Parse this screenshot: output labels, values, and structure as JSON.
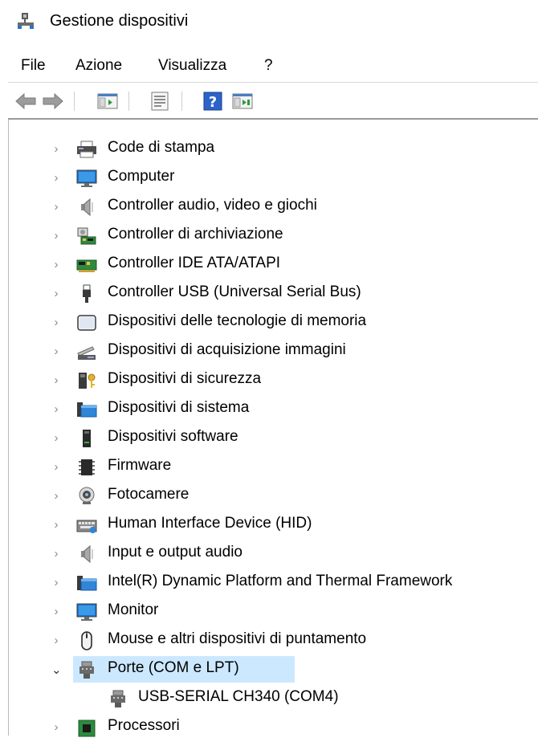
{
  "window": {
    "title": "Gestione dispositivi",
    "icon": "device-manager-icon"
  },
  "menu": [
    {
      "label": "File"
    },
    {
      "label": "Azione"
    },
    {
      "label": "Visualizza"
    },
    {
      "label": "?"
    }
  ],
  "toolbar": {
    "buttons": [
      "back-arrow-icon",
      "forward-arrow-icon",
      "show-hide-console-tree-icon",
      "properties-icon",
      "help-icon",
      "scan-hardware-icon"
    ]
  },
  "tree": {
    "items": [
      {
        "label": "Code di stampa",
        "icon": "printer-icon",
        "state": "collapsed"
      },
      {
        "label": "Computer",
        "icon": "computer-icon",
        "state": "collapsed"
      },
      {
        "label": "Controller audio, video e giochi",
        "icon": "speaker-icon",
        "state": "collapsed"
      },
      {
        "label": "Controller di archiviazione",
        "icon": "storage-controller-icon",
        "state": "collapsed"
      },
      {
        "label": "Controller IDE ATA/ATAPI",
        "icon": "ide-controller-icon",
        "state": "collapsed"
      },
      {
        "label": "Controller USB (Universal Serial Bus)",
        "icon": "usb-plug-icon",
        "state": "collapsed"
      },
      {
        "label": "Dispositivi delle tecnologie di memoria",
        "icon": "memory-device-icon",
        "state": "collapsed"
      },
      {
        "label": "Dispositivi di acquisizione immagini",
        "icon": "scanner-icon",
        "state": "collapsed"
      },
      {
        "label": "Dispositivi di sicurezza",
        "icon": "security-key-icon",
        "state": "collapsed"
      },
      {
        "label": "Dispositivi di sistema",
        "icon": "system-folder-icon",
        "state": "collapsed"
      },
      {
        "label": "Dispositivi software",
        "icon": "software-device-icon",
        "state": "collapsed"
      },
      {
        "label": "Firmware",
        "icon": "firmware-chip-icon",
        "state": "collapsed"
      },
      {
        "label": "Fotocamere",
        "icon": "webcam-icon",
        "state": "collapsed"
      },
      {
        "label": "Human Interface Device (HID)",
        "icon": "hid-keyboard-icon",
        "state": "collapsed"
      },
      {
        "label": "Input e output audio",
        "icon": "speaker-icon",
        "state": "collapsed"
      },
      {
        "label": "Intel(R) Dynamic Platform and Thermal Framework",
        "icon": "system-folder-icon",
        "state": "collapsed"
      },
      {
        "label": "Monitor",
        "icon": "monitor-icon",
        "state": "collapsed"
      },
      {
        "label": "Mouse e altri dispositivi di puntamento",
        "icon": "mouse-icon",
        "state": "collapsed"
      },
      {
        "label": "Porte (COM e LPT)",
        "icon": "port-connector-icon",
        "state": "expanded",
        "selected": true
      },
      {
        "label": "USB-SERIAL CH340 (COM4)",
        "icon": "port-connector-icon",
        "state": "child"
      },
      {
        "label": "Processori",
        "icon": "processor-icon",
        "state": "collapsed"
      }
    ]
  },
  "colors": {
    "selection": "#cce8ff",
    "accent_blue": "#1e73d2",
    "chevron": "#8a8a8a"
  }
}
